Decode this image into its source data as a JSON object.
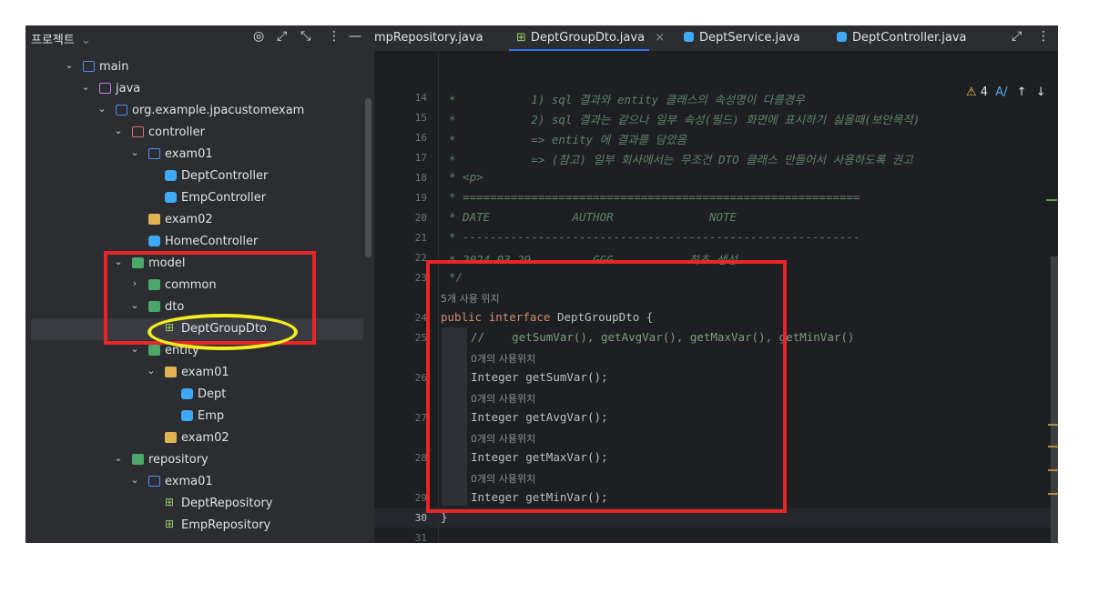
{
  "project_panel": {
    "title": "프로젝트",
    "title_chevron": "⌄",
    "tree": [
      {
        "label": "main",
        "icon": "source-folder-icon"
      },
      {
        "label": "java",
        "icon": "java-source-folder-icon"
      },
      {
        "label": "org.example.jpacustomexam",
        "icon": "package-icon"
      },
      {
        "label": "controller",
        "icon": "controller-package-icon"
      },
      {
        "label": "exam01",
        "icon": "package-icon"
      },
      {
        "label": "DeptController",
        "icon": "class-icon"
      },
      {
        "label": "EmpController",
        "icon": "class-icon"
      },
      {
        "label": "exam02",
        "icon": "folder-icon"
      },
      {
        "label": "HomeController",
        "icon": "class-icon"
      },
      {
        "label": "model",
        "icon": "module-folder-icon"
      },
      {
        "label": "common",
        "icon": "folder-icon"
      },
      {
        "label": "dto",
        "icon": "module-folder-icon"
      },
      {
        "label": "DeptGroupDto",
        "icon": "interface-icon"
      },
      {
        "label": "entity",
        "icon": "module-folder-icon"
      },
      {
        "label": "exam01",
        "icon": "folder-icon"
      },
      {
        "label": "Dept",
        "icon": "class-icon"
      },
      {
        "label": "Emp",
        "icon": "class-icon"
      },
      {
        "label": "exam02",
        "icon": "folder-icon"
      },
      {
        "label": "repository",
        "icon": "module-folder-icon"
      },
      {
        "label": "exma01",
        "icon": "package-icon"
      },
      {
        "label": "DeptRepository",
        "icon": "interface-icon"
      },
      {
        "label": "EmpRepository",
        "icon": "interface-icon"
      }
    ]
  },
  "tabs": [
    {
      "label": "mpRepository.java"
    },
    {
      "label": "DeptGroupDto.java",
      "active": true,
      "close": "×"
    },
    {
      "label": "DeptService.java"
    },
    {
      "label": "DeptController.java"
    }
  ],
  "inspection": {
    "warnings": "4",
    "warning_icon": "⚠"
  },
  "editor": {
    "line_numbers": [
      "14",
      "15",
      "16",
      "17",
      "18",
      "19",
      "20",
      "21",
      "22",
      "23",
      "24",
      "25",
      "26",
      "27",
      "28",
      "29",
      "30",
      "31"
    ],
    "comment_lines": [
      "*           1) sql 결과와 entity 클래스의 속성명이 다를경우",
      "*           2) sql 결과는 같으나 일부 속성(필드) 화면에 표시하기 싫을때(보안목적)",
      "*           => entity 에 결과를 담았음",
      "*           => (참고) 일부 회사에서는 무조건 DTO 클래스 만들어서 사용하도록 권고",
      "* <p>",
      "* ==========================================================",
      "* DATE            AUTHOR              NOTE",
      "* ----------------------------------------------------------",
      "* 2024-03-29         GGG           최초 생성",
      "*/"
    ],
    "usage_hint": "5개 사용 위치",
    "decl_kw1": "public",
    "decl_kw2": "interface",
    "decl_name": "DeptGroupDto",
    "decl_brace": "{",
    "line_comment": "//    getSumVar(), getAvgVar(), getMaxVar(), getMinVar()",
    "method_hint": "0개의 사용위치",
    "methods": [
      {
        "type": "Integer",
        "name": "getSumVar",
        "tail": "();"
      },
      {
        "type": "Integer",
        "name": "getAvgVar",
        "tail": "();"
      },
      {
        "type": "Integer",
        "name": "getMaxVar",
        "tail": "();"
      },
      {
        "type": "Integer",
        "name": "getMinVar",
        "tail": "();"
      }
    ],
    "closing_brace": "}"
  }
}
